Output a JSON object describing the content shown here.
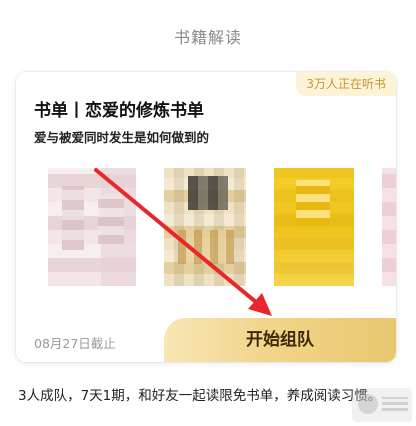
{
  "section": {
    "title": "书籍解读"
  },
  "card": {
    "badge": "3万人正在听书",
    "title": "书单丨恋爱的修炼书单",
    "subtitle": "爱与被爱同时发生是如何做到的",
    "deadline": "08月27日截止",
    "button_label": "开始组队",
    "covers": [
      "book-cover",
      "book-cover",
      "book-cover",
      "book-cover"
    ]
  },
  "description": "3人成队，7天1期，和好友一起读限免书单，养成阅读习惯。",
  "colors": {
    "accent_gold": "#f1d58a",
    "badge_text": "#c9962f",
    "annotation_arrow": "#e8262b"
  },
  "icons": {
    "annotation": "red-arrow-icon"
  }
}
